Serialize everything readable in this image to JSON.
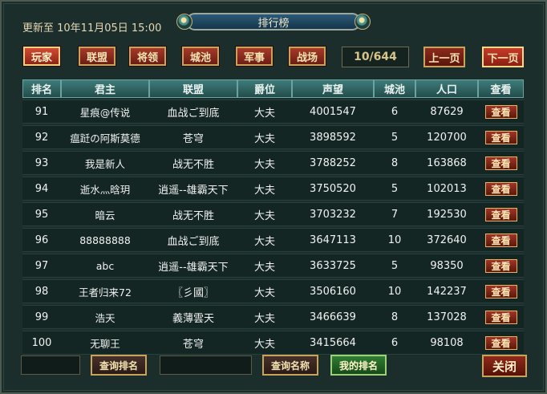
{
  "header": {
    "updated": "更新至 10年11月05日 15:00",
    "title": "排行榜"
  },
  "categories": [
    "玩家",
    "联盟",
    "将领",
    "城池",
    "军事",
    "战场"
  ],
  "pagination": {
    "indicator": "10/644",
    "prev": "上一页",
    "next": "下一页"
  },
  "table": {
    "headers": [
      "排名",
      "君主",
      "联盟",
      "爵位",
      "声望",
      "城池",
      "人口",
      "查看"
    ],
    "rows": [
      [
        "91",
        "星痕@传说",
        "血战ご到底",
        "大夫",
        "4001547",
        "6",
        "87629",
        "查看"
      ],
      [
        "92",
        "瘟跹の阿斯莫德",
        "苍穹",
        "大夫",
        "3898592",
        "5",
        "120700",
        "查看"
      ],
      [
        "93",
        "我是新人",
        "战无不胜",
        "大夫",
        "3788252",
        "8",
        "163868",
        "查看"
      ],
      [
        "94",
        "逝水灬晗玥",
        "逍遥--雄霸天下",
        "大夫",
        "3750520",
        "5",
        "102013",
        "查看"
      ],
      [
        "95",
        "暗云",
        "战无不胜",
        "大夫",
        "3703232",
        "7",
        "192530",
        "查看"
      ],
      [
        "96",
        "88888888",
        "血战ご到底",
        "大夫",
        "3647113",
        "10",
        "372640",
        "查看"
      ],
      [
        "97",
        "abc",
        "逍遥--雄霸天下",
        "大夫",
        "3633725",
        "5",
        "98350",
        "查看"
      ],
      [
        "98",
        "王者归来72",
        "〖彡國〗",
        "大夫",
        "3506160",
        "10",
        "142237",
        "查看"
      ],
      [
        "99",
        "浩天",
        "義薄雲天",
        "大夫",
        "3466639",
        "8",
        "137028",
        "查看"
      ],
      [
        "100",
        "无聊王",
        "苍穹",
        "大夫",
        "3415664",
        "6",
        "98108",
        "查看"
      ]
    ]
  },
  "footer": {
    "rank_input": "",
    "query_rank": "查询排名",
    "name_input": "",
    "query_name": "查询名称",
    "my_rank": "我的排名",
    "close": "关闭"
  }
}
